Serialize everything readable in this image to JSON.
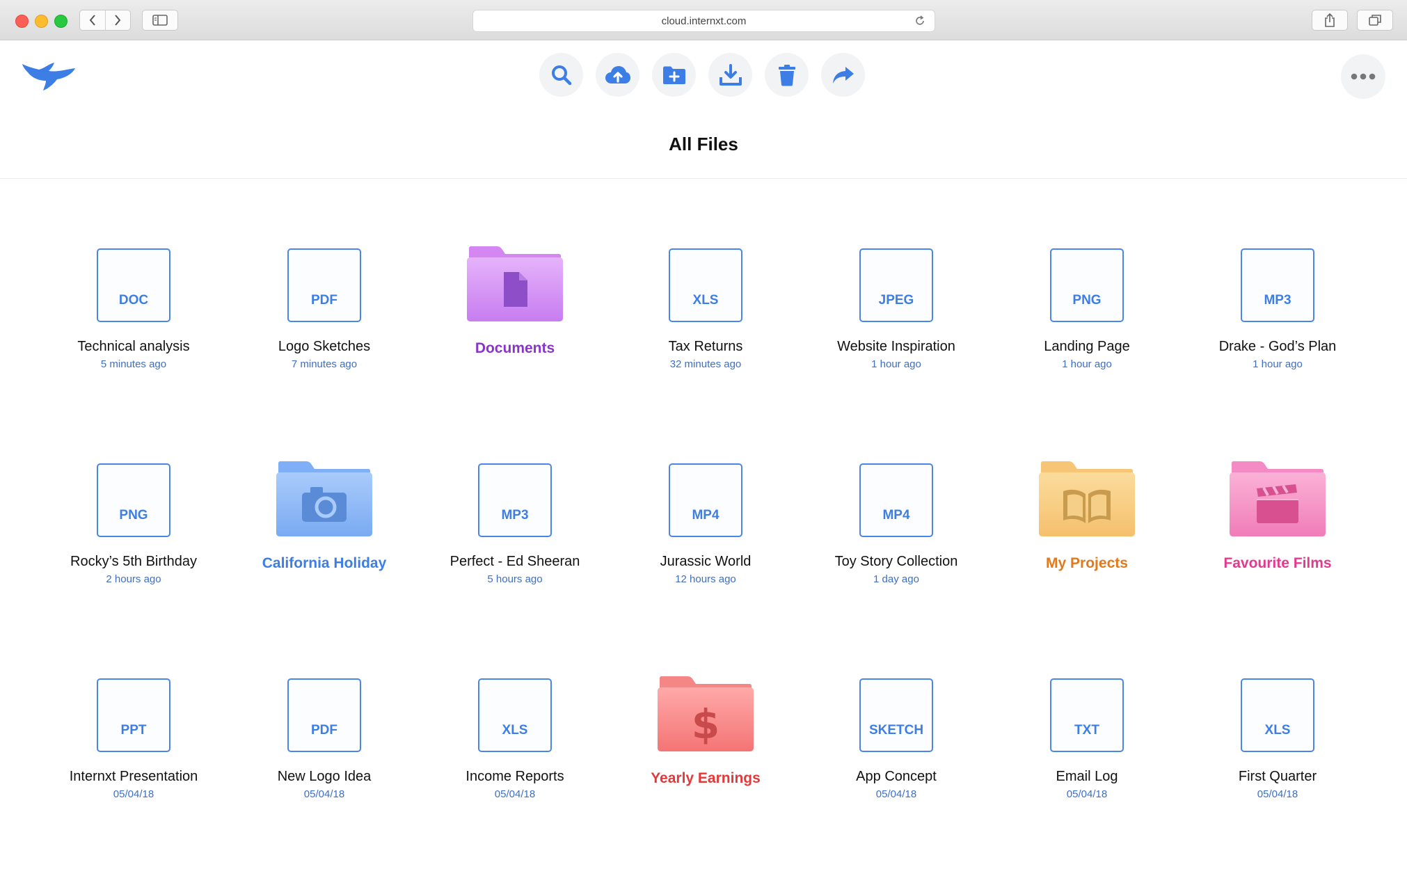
{
  "browser": {
    "url": "cloud.internxt.com"
  },
  "header": {
    "toolbar": [
      {
        "name": "search-button",
        "icon": "search-icon"
      },
      {
        "name": "upload-button",
        "icon": "cloud-upload-icon"
      },
      {
        "name": "new-folder-button",
        "icon": "folder-plus-icon"
      },
      {
        "name": "download-button",
        "icon": "download-icon"
      },
      {
        "name": "delete-button",
        "icon": "trash-icon"
      },
      {
        "name": "share-button",
        "icon": "share-arrow-icon"
      }
    ],
    "more_icon": "more-dots-icon"
  },
  "page": {
    "title": "All Files"
  },
  "colors": {
    "accent": "#3c7ee6",
    "documents": "#8a35c9",
    "california": "#3c7ee6",
    "projects": "#e07a1c",
    "films": "#e33a8e",
    "earnings": "#e23a3a"
  },
  "files": [
    {
      "kind": "file",
      "ext": "DOC",
      "name": "Technical analysis",
      "meta": "5 minutes ago"
    },
    {
      "kind": "file",
      "ext": "PDF",
      "name": "Logo Sketches",
      "meta": "7 minutes ago"
    },
    {
      "kind": "folder",
      "style": "purple",
      "icon": "document-icon",
      "name": "Documents",
      "color": "#8a35c9"
    },
    {
      "kind": "file",
      "ext": "XLS",
      "name": "Tax Returns",
      "meta": "32 minutes ago"
    },
    {
      "kind": "file",
      "ext": "JPEG",
      "name": "Website Inspiration",
      "meta": "1 hour ago"
    },
    {
      "kind": "file",
      "ext": "PNG",
      "name": "Landing Page",
      "meta": "1 hour ago"
    },
    {
      "kind": "file",
      "ext": "MP3",
      "name": "Drake - God’s Plan",
      "meta": "1 hour ago"
    },
    {
      "kind": "file",
      "ext": "PNG",
      "name": "Rocky’s 5th Birthday",
      "meta": "2 hours ago"
    },
    {
      "kind": "folder",
      "style": "blue",
      "icon": "camera-icon",
      "name": "California Holiday",
      "color": "#3c7ee6"
    },
    {
      "kind": "file",
      "ext": "MP3",
      "name": "Perfect - Ed Sheeran",
      "meta": "5 hours ago"
    },
    {
      "kind": "file",
      "ext": "MP4",
      "name": "Jurassic World",
      "meta": "12 hours ago"
    },
    {
      "kind": "file",
      "ext": "MP4",
      "name": "Toy Story Collection",
      "meta": "1 day ago"
    },
    {
      "kind": "folder",
      "style": "orange",
      "icon": "book-icon",
      "name": "My Projects",
      "color": "#e07a1c"
    },
    {
      "kind": "folder",
      "style": "pink",
      "icon": "clapperboard-icon",
      "name": "Favourite Films",
      "color": "#e33a8e"
    },
    {
      "kind": "file",
      "ext": "PPT",
      "name": "Internxt Presentation",
      "meta": "05/04/18"
    },
    {
      "kind": "file",
      "ext": "PDF",
      "name": "New Logo Idea",
      "meta": "05/04/18"
    },
    {
      "kind": "file",
      "ext": "XLS",
      "name": "Income Reports",
      "meta": "05/04/18"
    },
    {
      "kind": "folder",
      "style": "red",
      "icon": "dollar-icon",
      "name": "Yearly Earnings",
      "color": "#e23a3a"
    },
    {
      "kind": "file",
      "ext": "SKETCH",
      "name": "App Concept",
      "meta": "05/04/18"
    },
    {
      "kind": "file",
      "ext": "TXT",
      "name": "Email Log",
      "meta": "05/04/18"
    },
    {
      "kind": "file",
      "ext": "XLS",
      "name": "First Quarter",
      "meta": "05/04/18"
    }
  ]
}
